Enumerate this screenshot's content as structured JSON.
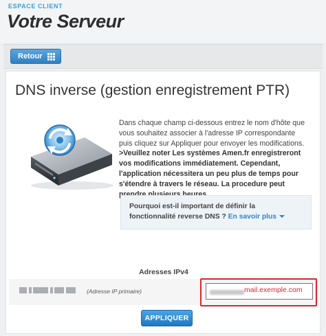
{
  "header": {
    "section_label": "ESPACE CLIENT",
    "title": "Votre Serveur"
  },
  "toolbar": {
    "back_label": "Retour",
    "back_icon": "grid-icon"
  },
  "main": {
    "title": "DNS inverse (gestion enregistrement PTR)",
    "description": "Dans chaque champ ci-dessous entrez le nom d'hôte que vous souhaitez associer à l'adresse IP correspondante puis cliquez sur Appliquer pour envoyer les modifications.",
    "notice": ">Veuillez noter Les systèmes Amen.fr enregistreront vos modifications immédiatement. Cependant, l'application nécessitera un peu plus de temps pour s'étendre à travers le réseau. La procedure peut prendre plusieurs heures.",
    "info_box": {
      "question": "Pourquoi est-il important de définir la fonctionnalité reverse DNS ?",
      "link": "En savoir plus"
    }
  },
  "ipv4": {
    "header": "Adresses IPv4",
    "rows": [
      {
        "ip_label": "(Adresse IP primaire)",
        "ptr_value": "mail.exemple.com"
      }
    ]
  },
  "actions": {
    "apply_label": "APPLIQUER"
  },
  "colors": {
    "accent_blue": "#2f86c8",
    "highlight_red": "#d9252b"
  }
}
